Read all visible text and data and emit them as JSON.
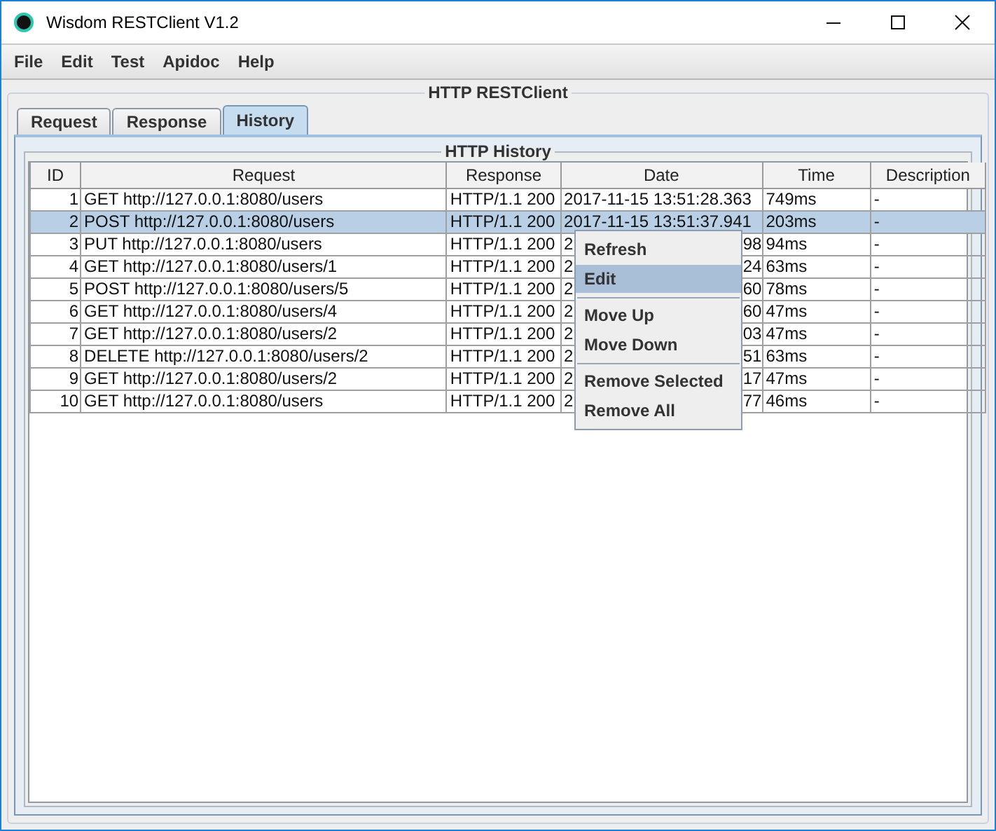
{
  "window": {
    "title": "Wisdom RESTClient V1.2"
  },
  "menu_bar": [
    "File",
    "Edit",
    "Test",
    "Apidoc",
    "Help"
  ],
  "outer_panel": {
    "title": "HTTP RESTClient"
  },
  "tabs": [
    {
      "label": "Request",
      "selected": false
    },
    {
      "label": "Response",
      "selected": false
    },
    {
      "label": "History",
      "selected": true
    }
  ],
  "history_panel": {
    "title": "HTTP History"
  },
  "table": {
    "columns": [
      "ID",
      "Request",
      "Response",
      "Date",
      "Time",
      "Description"
    ],
    "rows": [
      {
        "id": "1",
        "request": "GET http://127.0.0.1:8080/users",
        "response": "HTTP/1.1 200",
        "date": [
          "2017-11-15 13:51:28.363"
        ],
        "time": "749ms",
        "description": "-",
        "selected": false
      },
      {
        "id": "2",
        "request": "POST http://127.0.0.1:8080/users",
        "response": "HTTP/1.1 200",
        "date": [
          "2017-11-15 13:51:37.941"
        ],
        "time": "203ms",
        "description": "-",
        "selected": true
      },
      {
        "id": "3",
        "request": "PUT http://127.0.0.1:8080/users",
        "response": "HTTP/1.1 200",
        "date": [
          "2",
          "98"
        ],
        "time": "94ms",
        "description": "-",
        "selected": false
      },
      {
        "id": "4",
        "request": "GET http://127.0.0.1:8080/users/1",
        "response": "HTTP/1.1 200",
        "date": [
          "2",
          "24"
        ],
        "time": "63ms",
        "description": "-",
        "selected": false
      },
      {
        "id": "5",
        "request": "POST http://127.0.0.1:8080/users/5",
        "response": "HTTP/1.1 200",
        "date": [
          "2",
          "60"
        ],
        "time": "78ms",
        "description": "-",
        "selected": false
      },
      {
        "id": "6",
        "request": "GET http://127.0.0.1:8080/users/4",
        "response": "HTTP/1.1 200",
        "date": [
          "2",
          "60"
        ],
        "time": "47ms",
        "description": "-",
        "selected": false
      },
      {
        "id": "7",
        "request": "GET http://127.0.0.1:8080/users/2",
        "response": "HTTP/1.1 200",
        "date": [
          "2",
          "03"
        ],
        "time": "47ms",
        "description": "-",
        "selected": false
      },
      {
        "id": "8",
        "request": "DELETE http://127.0.0.1:8080/users/2",
        "response": "HTTP/1.1 200",
        "date": [
          "2",
          "51"
        ],
        "time": "63ms",
        "description": "-",
        "selected": false
      },
      {
        "id": "9",
        "request": "GET http://127.0.0.1:8080/users/2",
        "response": "HTTP/1.1 200",
        "date": [
          "2",
          "17"
        ],
        "time": "47ms",
        "description": "-",
        "selected": false
      },
      {
        "id": "10",
        "request": "GET http://127.0.0.1:8080/users",
        "response": "HTTP/1.1 200",
        "date": [
          "2",
          "77"
        ],
        "time": "46ms",
        "description": "-",
        "selected": false
      }
    ]
  },
  "context_menu": [
    {
      "kind": "item",
      "label": "Refresh",
      "selected": false
    },
    {
      "kind": "item",
      "label": "Edit",
      "selected": true
    },
    {
      "kind": "separator"
    },
    {
      "kind": "item",
      "label": "Move Up",
      "selected": false
    },
    {
      "kind": "item",
      "label": "Move Down",
      "selected": false
    },
    {
      "kind": "separator"
    },
    {
      "kind": "item",
      "label": "Remove Selected",
      "selected": false
    },
    {
      "kind": "item",
      "label": "Remove All",
      "selected": false
    }
  ]
}
